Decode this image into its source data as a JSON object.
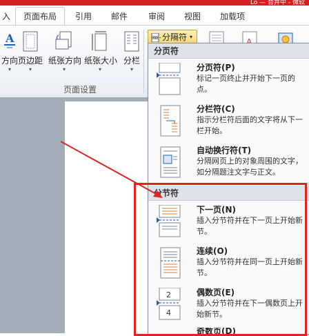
{
  "window": {
    "title_fragment": "Lo — 合并中 - 微软"
  },
  "tabs": [
    {
      "label": "入"
    },
    {
      "label": "页面布局"
    },
    {
      "label": "引用"
    },
    {
      "label": "邮件"
    },
    {
      "label": "审阅"
    },
    {
      "label": "视图"
    },
    {
      "label": "加载项"
    }
  ],
  "ribbon": {
    "buttons": [
      {
        "label": "方向",
        "icon": "text-direction-icon"
      },
      {
        "label": "页边距",
        "icon": "margins-icon"
      },
      {
        "label": "纸张方向",
        "icon": "orientation-icon"
      },
      {
        "label": "纸张大小",
        "icon": "paper-size-icon"
      },
      {
        "label": "分栏",
        "icon": "columns-icon"
      }
    ],
    "breaks_button": "分隔符",
    "group_label": "页面设置"
  },
  "menu": {
    "sections": [
      {
        "header": "分页符",
        "items": [
          {
            "title": "分页符(P)",
            "description": "标记一页终止并开始下一页的点。"
          },
          {
            "title": "分栏符(C)",
            "description": "指示分栏符后面的文字将从下一栏开始。"
          },
          {
            "title": "自动换行符(T)",
            "description": "分隔网页上的对象周围的文字，如分隔题注文字与正文。"
          }
        ]
      },
      {
        "header": "分节符",
        "items": [
          {
            "title": "下一页(N)",
            "description": "插入分节符并在下一页上开始新节。"
          },
          {
            "title": "连续(O)",
            "description": "插入分节符并在同一页上开始新节。"
          },
          {
            "title": "偶数页(E)",
            "description": "插入分节符并在下一偶数页上开始新节。"
          },
          {
            "title": "奇数页(D)",
            "description": ""
          }
        ]
      }
    ]
  },
  "colors": {
    "accent_red": "#e02424",
    "ribbon_active_yellow": "#f8d771"
  }
}
